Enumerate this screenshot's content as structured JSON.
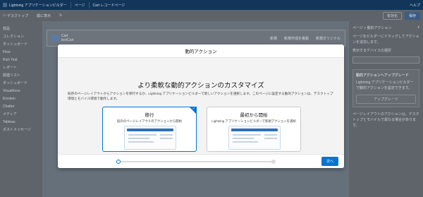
{
  "topbar": {
    "app_name": "Lightning アプリケーションビルダー",
    "pages_label": "ページ",
    "page_name": "Cart レコードページ",
    "help_label": "ヘルプ"
  },
  "toolbar": {
    "device_label": "デスクトップ",
    "view_label": "縦に表示",
    "activate_label": "有効化",
    "save_label": "保存"
  },
  "left_panel": {
    "title": "部品",
    "items": [
      "コレクション",
      "ダッシュボード",
      "Flow",
      "Rich Text",
      "レポート",
      "関連リスト",
      "ダッシュボード",
      "Visualforce",
      "Einstein",
      "Chatter",
      "メディア",
      "Tableau",
      "ポストメッセージ"
    ]
  },
  "record_header": {
    "object": "Cart",
    "record": "testCart",
    "actions": [
      "新規",
      "新規作成を複製",
      "新規オリジナル"
    ]
  },
  "right_panel": {
    "title": "ページ > 動的アクション",
    "text1": "ページをビルダーにドラッグしてアクションを追加します。",
    "label": "表示するデバイスの選択",
    "warn_title": "動的アクションへアップグレード",
    "warn_text": "Lightning アプリケーションビルダーで動的アクションを設定できます。",
    "upgrade_btn": "アップグレード",
    "more_text": "ページレイアウトのアクションは、デスクトップとモバイルで異なる場合があります。"
  },
  "modal": {
    "title": "動的アクション",
    "headline": "より柔軟な動的アクションのカスタマイズ",
    "description": "既存のページレイアウトからアクションを移行するか、Lightning アプリケーションビルダーで新しいアクションを選択します。このページに設定する動的アクションは、デスクトップ環境とモバイル環境で動作します。",
    "cards": [
      {
        "title": "移行",
        "subtitle": "既存のページレイアウトのアクションから開始"
      },
      {
        "title": "最初から開始",
        "subtitle": "Lightning アプリケーションビルダーで新規アクションを選択"
      }
    ],
    "next_label": "次へ",
    "step": 1,
    "total_steps": 2
  },
  "colors": {
    "brand": "#0176d3",
    "topbar": "#11365a"
  }
}
